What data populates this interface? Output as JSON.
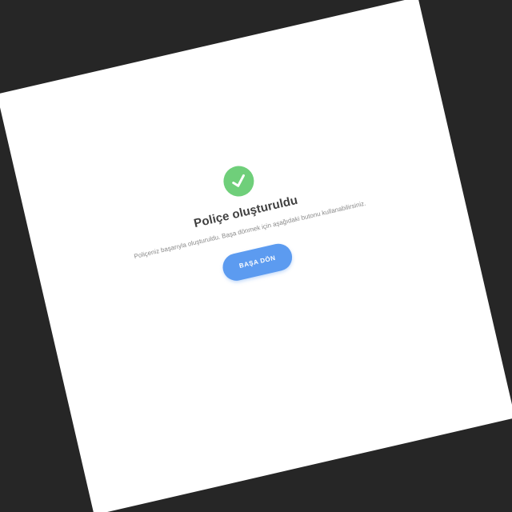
{
  "success": {
    "icon": "check-icon",
    "color": "#6fcf7a"
  },
  "title": "Poliçe oluşturuldu",
  "message": "Poliçeniz başarıyla oluşturuldu. Başa dönmek için aşağıdaki butonu kullanabilirsiniz.",
  "back_button": {
    "label": "BAŞA DÖN",
    "color": "#5c9bf0"
  }
}
